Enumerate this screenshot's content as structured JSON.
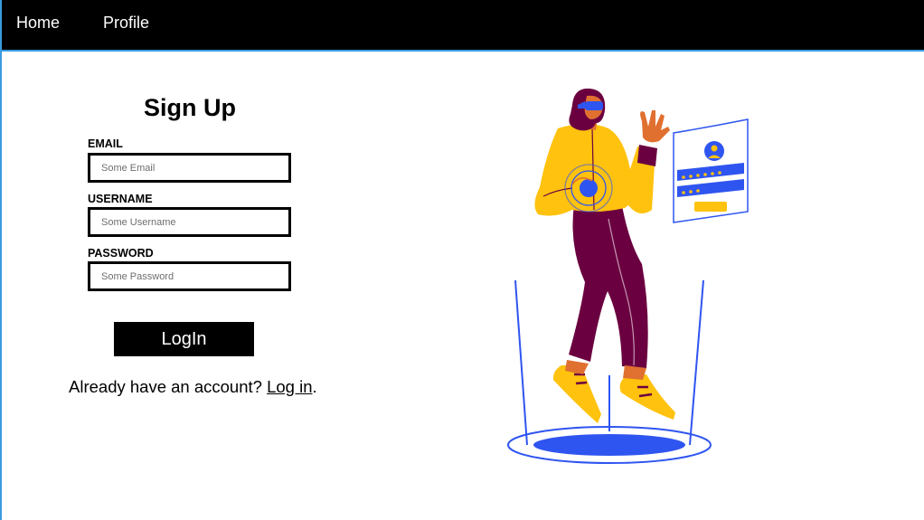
{
  "nav": {
    "home_label": "Home",
    "profile_label": "Profile"
  },
  "form": {
    "title": "Sign Up",
    "email": {
      "label": "EMAIL",
      "placeholder": "Some Email"
    },
    "username": {
      "label": "USERNAME",
      "placeholder": "Some Username"
    },
    "password": {
      "label": "PASSWORD",
      "placeholder": "Some Password"
    },
    "submit_label": "LogIn",
    "footer_prefix": "Already have an account? ",
    "footer_link": "Log in",
    "footer_suffix": "."
  },
  "illustration": {
    "icon": "person-vr-login-illustration-icon"
  },
  "colors": {
    "navbar": "#000000",
    "accent_border": "#3a9be0",
    "button": "#000000",
    "illustration_blue": "#2f55f0",
    "illustration_yellow": "#ffc20e",
    "illustration_maroon": "#6b0040"
  }
}
